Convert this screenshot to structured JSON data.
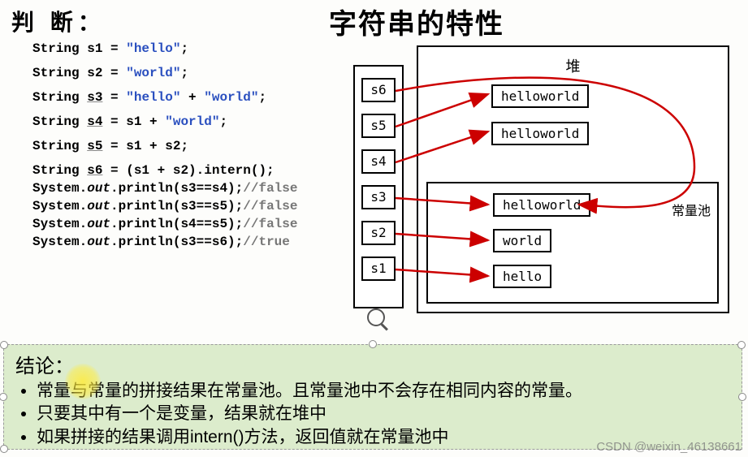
{
  "headings": {
    "judge": "判 断：",
    "title": "字符串的特性"
  },
  "code": {
    "line1": {
      "pre": "String s1 = ",
      "str": "\"hello\"",
      "post": ";"
    },
    "line2": {
      "pre": "String s2 = ",
      "str": "\"world\"",
      "post": ";"
    },
    "line3": {
      "pre": "String ",
      "var": "s3",
      "mid": " = ",
      "str1": "\"hello\"",
      "plus": " + ",
      "str2": "\"world\"",
      "post": ";"
    },
    "line4": {
      "pre": "String ",
      "var": "s4",
      "mid": " = s1 + ",
      "str": "\"world\"",
      "post": ";"
    },
    "line5": {
      "pre": "String ",
      "var": "s5",
      "post": " = s1 + s2;"
    },
    "line6": {
      "pre": "String ",
      "var": "s6",
      "post": " = (s1 + s2).intern();"
    },
    "line7": {
      "pre": "System.",
      "out": "out",
      "post": ".println(s3==s4);",
      "cmt": "//false"
    },
    "line8": {
      "pre": "System.",
      "out": "out",
      "post": ".println(s3==s5);",
      "cmt": "//false"
    },
    "line9": {
      "pre": "System.",
      "out": "out",
      "post": ".println(s4==s5);",
      "cmt": "//false"
    },
    "line10": {
      "pre": "System.",
      "out": "out",
      "post": ".println(s3==s6);",
      "cmt": "//true"
    }
  },
  "diagram": {
    "stack_cells": [
      "s6",
      "s5",
      "s4",
      "s3",
      "s2",
      "s1"
    ],
    "heap_label": "堆",
    "pool_label": "常量池",
    "heap_objs": {
      "hw1": "helloworld",
      "hw2": "helloworld"
    },
    "pool_objs": {
      "hw3": "helloworld",
      "world": "world",
      "hello": "hello"
    }
  },
  "conclusion": {
    "title": "结论：",
    "items": [
      "常量与常量的拼接结果在常量池。且常量池中不会存在相同内容的常量。",
      "只要其中有一个是变量，结果就在堆中",
      "如果拼接的结果调用intern()方法，返回值就在常量池中"
    ]
  },
  "watermark": "CSDN @weixin_46138661"
}
